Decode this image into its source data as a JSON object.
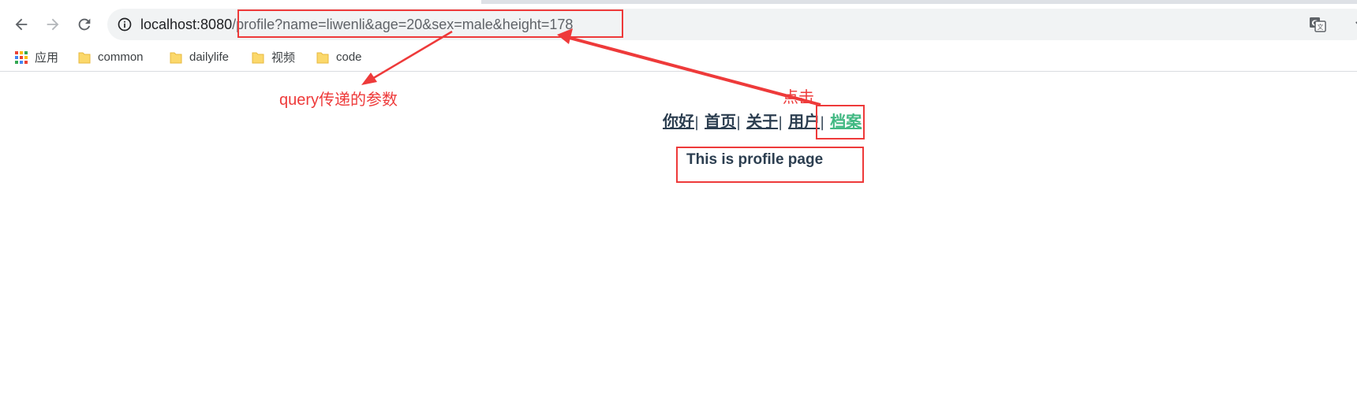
{
  "browser": {
    "address_bar": {
      "host": "localhost:8080",
      "path": "/profile?name=liwenli&age=20&sex=male&height=178"
    },
    "bookmarks": [
      {
        "label": "应用",
        "icon": "apps-grid-icon"
      },
      {
        "label": "common",
        "icon": "folder-icon"
      },
      {
        "label": "dailylife",
        "icon": "folder-icon"
      },
      {
        "label": "视频",
        "icon": "folder-icon"
      },
      {
        "label": "code",
        "icon": "folder-icon"
      }
    ]
  },
  "app_nav": {
    "links": [
      {
        "label": "你好",
        "active": false
      },
      {
        "label": "首页",
        "active": false
      },
      {
        "label": "关于",
        "active": false
      },
      {
        "label": "用户",
        "active": false
      },
      {
        "label": "档案",
        "active": true
      }
    ],
    "separator": "|"
  },
  "page": {
    "text": "This is profile page"
  },
  "annotations": {
    "query_label": "query传递的参数",
    "click_label": "点击"
  },
  "colors": {
    "annotation": "#ee3a3a",
    "link": "#2c3e50",
    "active_link": "#42b983"
  }
}
